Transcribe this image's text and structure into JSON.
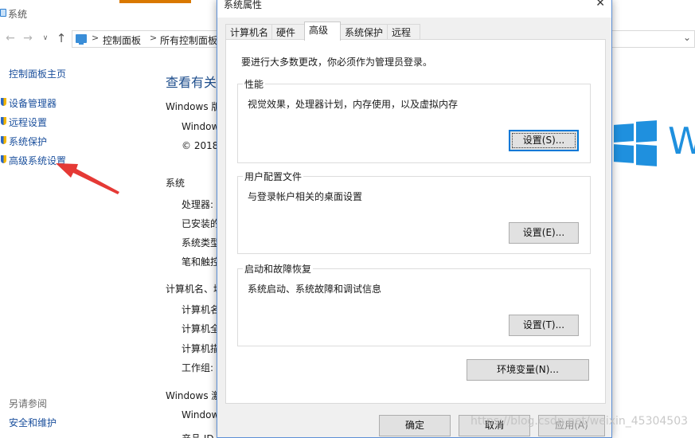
{
  "background_window": {
    "title": "系统",
    "breadcrumb": [
      "控制面板",
      "所有控制面板"
    ],
    "breadcrumb_sep": ">",
    "left_pane": {
      "home": "控制面板主页",
      "links": [
        "设备管理器",
        "远程设置",
        "系统保护",
        "高级系统设置"
      ],
      "see_also": "另请参阅",
      "security": "安全和维护"
    },
    "main": {
      "heading": "查看有关",
      "edition_section": "Windows 版",
      "edition_name": "Window",
      "copyright": "© 2018",
      "system_section": "系统",
      "processor": "处理器:",
      "installed_ram": "已安装的",
      "system_type": "系统类型",
      "pen_touch": "笔和触控",
      "computer_section": "计算机名、域",
      "computer_name": "计算机名",
      "full_name": "计算机全",
      "description": "计算机描",
      "workgroup": "工作组:",
      "activation_section": "Windows 激",
      "activation_line": "Window",
      "product_id": "产品 ID"
    },
    "logo_letter": "W"
  },
  "dialog": {
    "title": "系统属性",
    "close": "✕",
    "tabs": [
      "计算机名",
      "硬件",
      "高级",
      "系统保护",
      "远程"
    ],
    "active_tab": "高级",
    "admin_note": "要进行大多数更改，你必须作为管理员登录。",
    "groups": {
      "performance": {
        "title": "性能",
        "desc": "视觉效果，处理器计划，内存使用，以及虚拟内存",
        "button": "设置(S)..."
      },
      "profiles": {
        "title": "用户配置文件",
        "desc": "与登录帐户相关的桌面设置",
        "button": "设置(E)..."
      },
      "startup": {
        "title": "启动和故障恢复",
        "desc": "系统启动、系统故障和调试信息",
        "button": "设置(T)..."
      }
    },
    "env_button": "环境变量(N)...",
    "ok": "确定",
    "cancel": "取消",
    "apply": "应用(A)"
  },
  "watermark": "https://blog.csdn.net/weixin_45304503",
  "colors": {
    "accent": "#0078d7",
    "link": "#1a4f9c",
    "arrow": "#e53935",
    "logo": "#1f90de"
  },
  "icons": {
    "back": "arrow-left-icon",
    "forward": "arrow-right-icon",
    "up": "arrow-up-icon",
    "close": "close-icon"
  }
}
